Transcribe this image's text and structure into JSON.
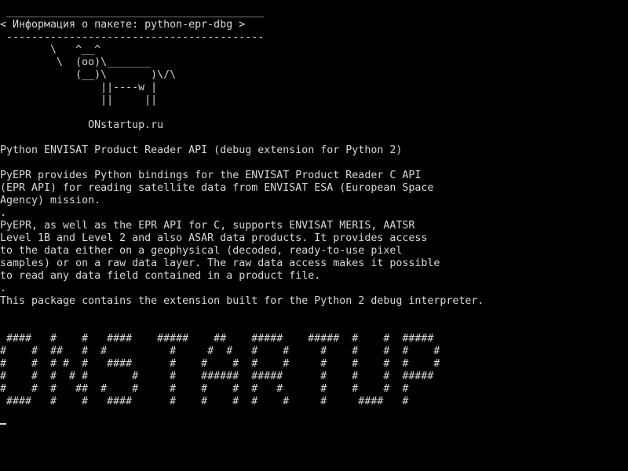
{
  "colors": {
    "background": "#000000",
    "text": "#d8d8d8"
  },
  "terminal": {
    "lines": [
      " _________________________________________",
      "< Информация о пакете: python-epr-dbg >",
      " -----------------------------------------",
      "        \\   ^__^",
      "         \\  (oo)\\_______",
      "            (__)\\       )\\/\\",
      "                ||----w |",
      "                ||     ||",
      "",
      "              ONstartup.ru",
      "",
      "Python ENVISAT Product Reader API (debug extension for Python 2)",
      "",
      "PyEPR provides Python bindings for the ENVISAT Product Reader C API",
      "(EPR API) for reading satellite data from ENVISAT ESA (European Space",
      "Agency) mission.",
      ".",
      "PyEPR, as well as the EPR API for C, supports ENVISAT MERIS, AATSR",
      "Level 1B and Level 2 and also ASAR data products. It provides access",
      "to the data either on a geophysical (decoded, ready-to-use pixel",
      "samples) or on a raw data layer. The raw data access makes it possible",
      "to read any data field contained in a product file.",
      ".",
      "This package contains the extension built for the Python 2 debug interpreter.",
      "",
      "",
      " ####   #    #   ####    #####    ##    #####    #####  #    #  #####",
      "#    #  ##   #  #          #     #  #   #    #     #    #    #  #    #",
      "#    #  # #  #   ####      #    #    #  #    #     #    #    #  #    #",
      "#    #  #  # #       #     #    ######  #####      #    #    #  #####",
      "#    #  #   ##  #    #     #    #    #  #   #      #    #    #  #",
      " ####   #    #   ####      #    #    #  #    #     #     ####   #"
    ]
  }
}
